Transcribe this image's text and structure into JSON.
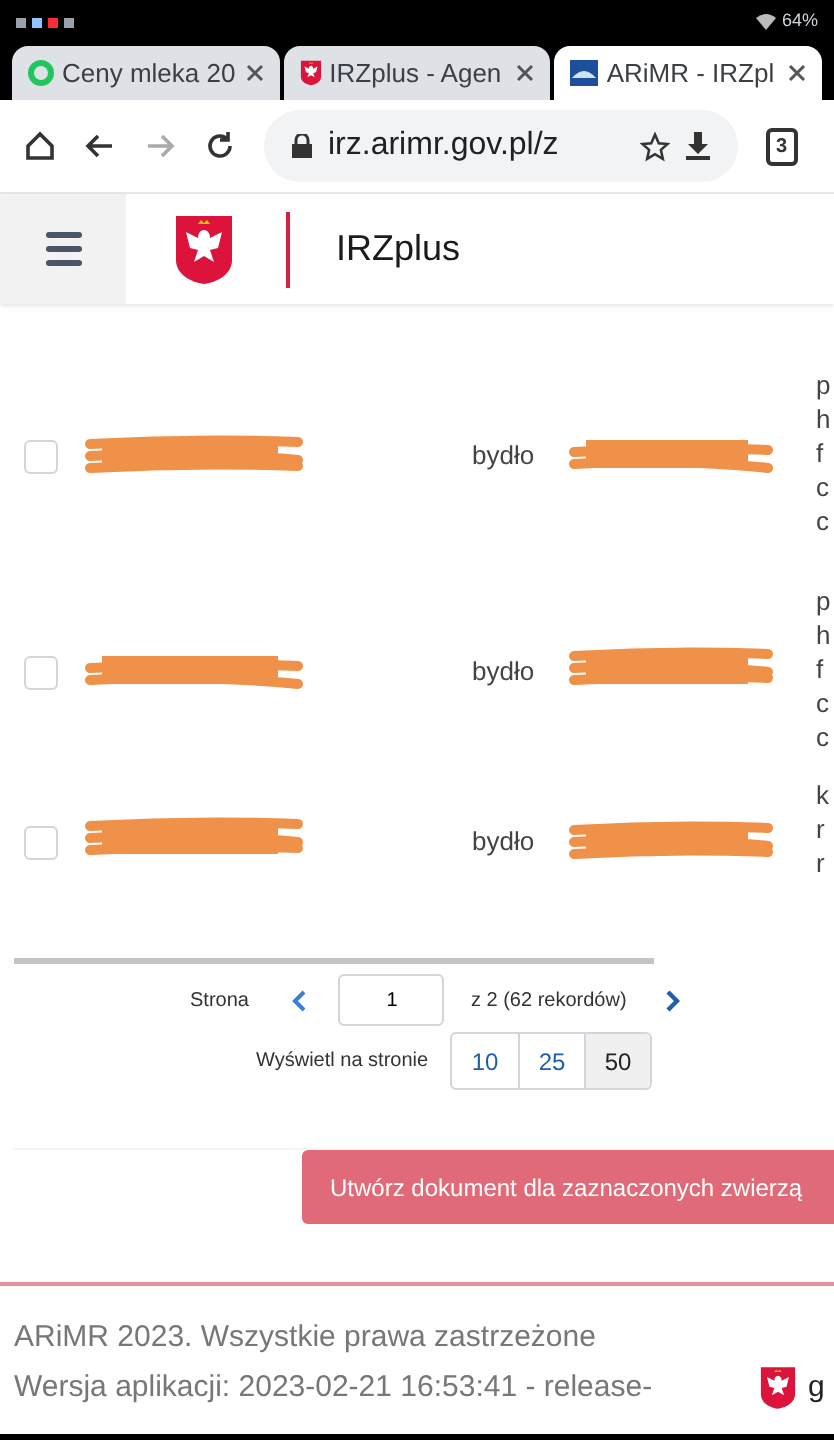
{
  "status_bar": {
    "battery": "64%"
  },
  "browser_tabs": [
    {
      "title": "Ceny mleka 20",
      "kind": "green",
      "selected": false
    },
    {
      "title": "IRZplus - Agen",
      "kind": "emblem",
      "selected": false
    },
    {
      "title": "ARiMR - IRZpl",
      "kind": "arimr",
      "selected": true
    }
  ],
  "address_bar": {
    "url": "irz.arimr.gov.pl/z",
    "tab_count": "3"
  },
  "app_header": {
    "title": "IRZplus"
  },
  "rows": [
    {
      "checked": false,
      "species": "bydło",
      "column_4": [
        "p",
        "h",
        "f",
        "c",
        "c"
      ]
    },
    {
      "checked": false,
      "species": "bydło",
      "column_4": [
        "p",
        "h",
        "f",
        "c",
        "c"
      ]
    },
    {
      "checked": false,
      "species": "bydło",
      "column_4": [
        "k",
        "r",
        "r"
      ]
    }
  ],
  "pagination": {
    "label": "Strona",
    "page": "1",
    "total": "z 2 (62 rekordów)",
    "per_page_label": "Wyświetl na stronie",
    "page_sizes": [
      {
        "label": "10",
        "selected": false
      },
      {
        "label": "25",
        "selected": false
      },
      {
        "label": "50",
        "selected": true
      }
    ]
  },
  "action_button": "Utwórz dokument dla zaznaczonych zwierzą",
  "footer": {
    "copyright": "ARiMR 2023. Wszystkie prawa zastrzeżone",
    "version": "Wersja aplikacji: 2023-02-21 16:53:41 - release-",
    "cut_text": "g"
  }
}
